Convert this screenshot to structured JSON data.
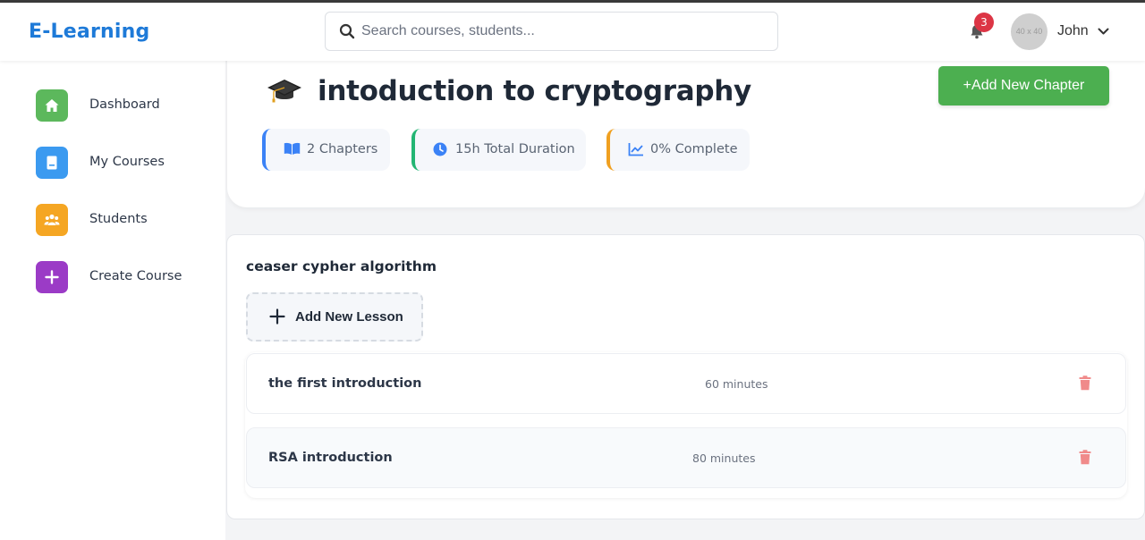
{
  "app": {
    "logo": "E-Learning"
  },
  "search": {
    "placeholder": "Search courses, students..."
  },
  "header": {
    "notification_count": "3",
    "avatar_text": "40 x 40",
    "username": "John"
  },
  "sidebar": {
    "items": [
      {
        "label": "Dashboard",
        "icon": "home-icon",
        "color": "#5cb85c"
      },
      {
        "label": "My Courses",
        "icon": "book-icon",
        "color": "#3b9af0"
      },
      {
        "label": "Students",
        "icon": "users-icon",
        "color": "#f5a623"
      },
      {
        "label": "Create Course",
        "icon": "plus-icon",
        "color": "#9b3bc6"
      }
    ]
  },
  "course": {
    "title": "intoduction to cryptography",
    "add_chapter_label": "+Add New Chapter",
    "stats": [
      {
        "label": "2 Chapters",
        "icon": "book-open-icon",
        "accent": "#3b82f6"
      },
      {
        "label": "15h Total Duration",
        "icon": "clock-icon",
        "accent": "#22b573"
      },
      {
        "label": "0% Complete",
        "icon": "chart-line-icon",
        "accent": "#f0a020"
      }
    ]
  },
  "chapter": {
    "title": "ceaser cypher algorithm",
    "add_lesson_label": "Add New Lesson",
    "lessons": [
      {
        "name": "the first introduction",
        "duration": "60 minutes"
      },
      {
        "name": "RSA introduction",
        "duration": "80 minutes"
      }
    ]
  },
  "colors": {
    "brand": "#1e7ad8",
    "success": "#4caf50",
    "danger": "#dc3545",
    "trash": "#f08a8a"
  }
}
